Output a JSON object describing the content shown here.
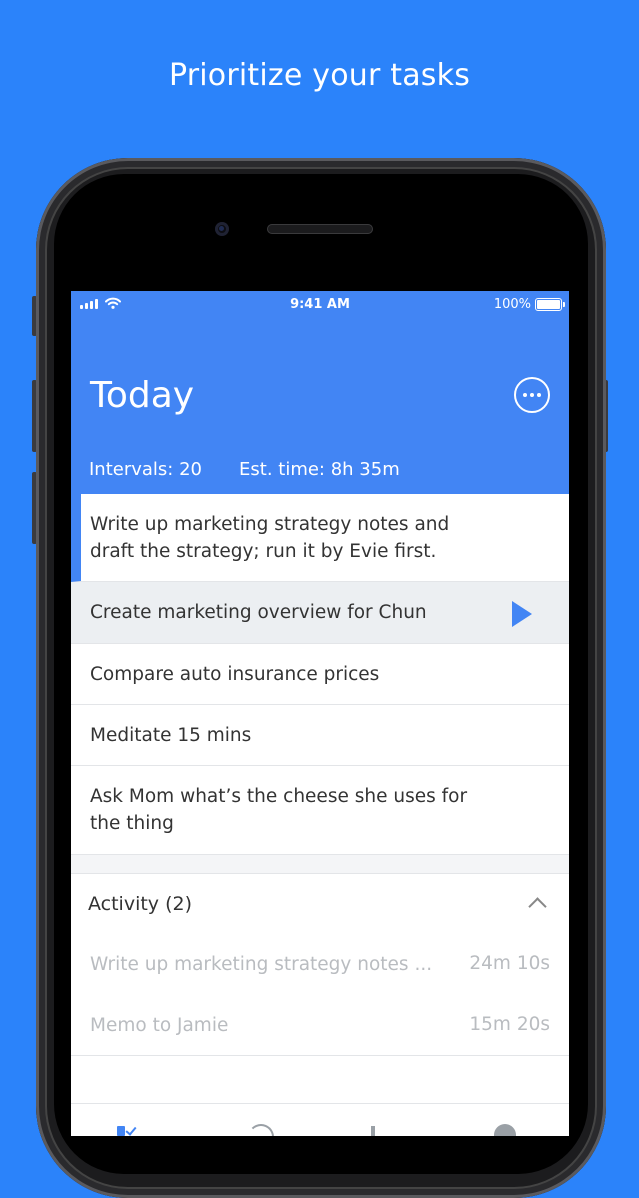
{
  "headline": "Prioritize your tasks",
  "status_bar": {
    "time": "9:41 AM",
    "battery": "100%"
  },
  "header": {
    "title": "Today",
    "intervals": "Intervals: 20",
    "est_time": "Est. time: 8h 35m"
  },
  "tasks": [
    {
      "text": "Write up marketing strategy notes and draft the strategy; run it by Evie first."
    },
    {
      "text": "Create marketing overview for Chun"
    },
    {
      "text": "Compare auto insurance prices"
    },
    {
      "text": "Meditate 15 mins"
    },
    {
      "text": "Ask Mom what’s the cheese she uses for the thing"
    }
  ],
  "activity": {
    "title": "Activity (2)",
    "items": [
      {
        "text": "Write up marketing strategy notes ...",
        "duration": "24m 10s"
      },
      {
        "text": "Memo to Jamie",
        "duration": "15m 20s"
      }
    ]
  },
  "icons": {
    "more": "more-horizontal-icon",
    "play": "play-icon",
    "chevron": "chevron-up-icon",
    "tabs": [
      "tasks-check-icon",
      "history-icon",
      "stats-icon",
      "settings-icon"
    ]
  },
  "colors": {
    "background": "#2b83fa",
    "app_bar": "#4285f4",
    "accent": "#4285f4",
    "selected_row": "#eceff2"
  }
}
